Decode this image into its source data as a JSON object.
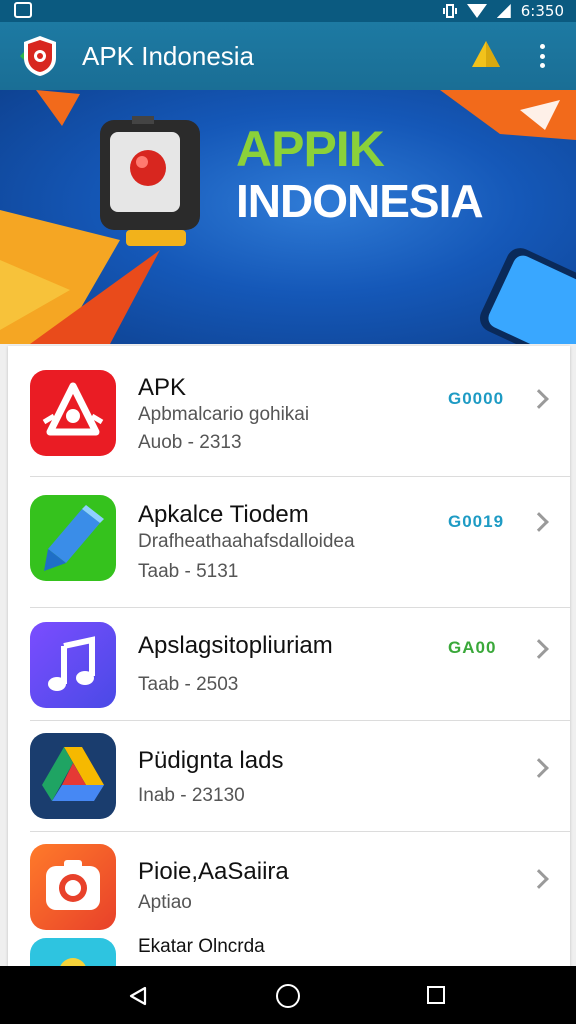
{
  "status_bar": {
    "time": "6:350"
  },
  "app_bar": {
    "title": "APK Indonesia"
  },
  "banner": {
    "title_line1": "APPIK",
    "title_line2": "INDONESIA"
  },
  "apps": [
    {
      "name": "APK",
      "subtitle": "Apbmalcario gohikai",
      "meta": "Auob - 2313",
      "badge": "G0000",
      "badge_color": "#1e9bc4",
      "icon": "alert-bell-icon"
    },
    {
      "name": "Apkalce  Tiodem",
      "subtitle": "Drafheathaahafsdalloidea",
      "meta": "Taab - 5131",
      "badge": "G0019",
      "badge_color": "#1e9bc4",
      "icon": "brush-icon"
    },
    {
      "name": "Apslagsitopliuriam",
      "subtitle": "",
      "meta": "Taab - 2503",
      "badge": "GA00",
      "badge_color": "#3aa83a",
      "icon": "music-note-icon"
    },
    {
      "name": "Püdignta lads",
      "subtitle": "",
      "meta": "Inab - 23130",
      "badge": "",
      "badge_color": "",
      "icon": "drive-icon"
    },
    {
      "name": "Pioie,AaSaiira",
      "subtitle": "",
      "meta": "Aptiao",
      "badge": "",
      "badge_color": "",
      "icon": "camera-icon"
    },
    {
      "name": "Ekatar Olncrda",
      "subtitle": "",
      "meta": "",
      "badge": "",
      "badge_color": "",
      "icon": "app-icon"
    }
  ]
}
